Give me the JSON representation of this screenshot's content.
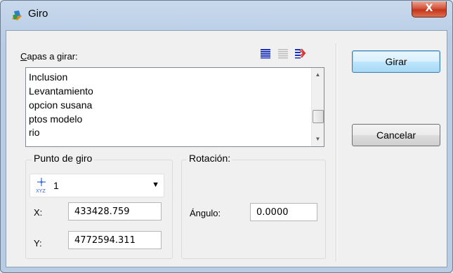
{
  "window": {
    "title": "Giro",
    "close_glyph": "X",
    "app_icon": "layer-app-icon"
  },
  "layers": {
    "label": "Capas a girar:",
    "label_access_key": "C",
    "label_rest": "apas a girar:",
    "tools": [
      "select-all-icon",
      "select-none-icon",
      "invert-selection-icon"
    ],
    "items": [
      "Inclusion",
      "Levantamiento",
      "opcion susana",
      "ptos modelo",
      "rio"
    ]
  },
  "pivot": {
    "group_label": "Punto de giro",
    "selected_value": "1",
    "icon": "xyz-point-icon",
    "icon_text": "XYZ",
    "x_label": "X:",
    "x_value": "433428.759",
    "y_label": "Y:",
    "y_value": "4772594.311"
  },
  "rotation": {
    "group_label": "Rotación:",
    "angle_label": "Ángulo:",
    "angle_value": "0.0000"
  },
  "buttons": {
    "rotate": "Girar",
    "cancel": "Cancelar"
  },
  "colors": {
    "title_bar": "#bcd0e7",
    "close_button": "#c3351c",
    "select_all": "#1a2fb8",
    "invert": "#d83030"
  }
}
